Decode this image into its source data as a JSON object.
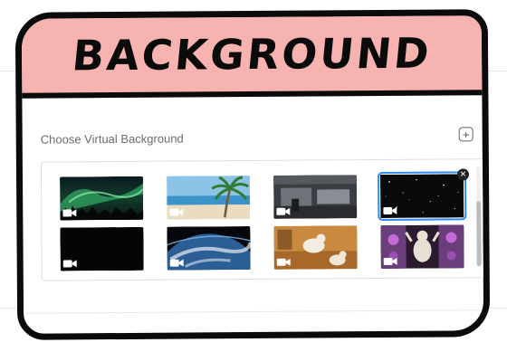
{
  "banner": {
    "title": "BACKGROUND"
  },
  "section": {
    "label": "Choose Virtual Background",
    "add_icon": "plus-square-icon"
  },
  "backgrounds": [
    {
      "name": "aurora",
      "selected": false
    },
    {
      "name": "beach-palm",
      "selected": false
    },
    {
      "name": "spaceship-hangar",
      "selected": false
    },
    {
      "name": "starfield",
      "selected": true
    },
    {
      "name": "black",
      "selected": false
    },
    {
      "name": "earth-from-space",
      "selected": false
    },
    {
      "name": "dogs-on-floor",
      "selected": false
    },
    {
      "name": "cat-purple-party",
      "selected": false
    }
  ],
  "icons": {
    "camera": "video-camera-icon",
    "remove": "close-icon"
  },
  "colors": {
    "banner": "#f6b3b0",
    "outline": "#0b0b0b",
    "selected": "#2d8cff"
  }
}
